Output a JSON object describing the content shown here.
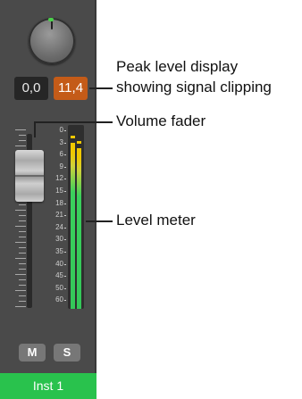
{
  "channel_strip": {
    "pan_knob": "pan-knob",
    "volume_display": "0,0",
    "peak_display": "11,4",
    "peak_color": "#c45b18",
    "meter_scale": [
      "0",
      "3",
      "6",
      "9",
      "12",
      "15",
      "18",
      "21",
      "24",
      "30",
      "35",
      "40",
      "45",
      "50",
      "60"
    ],
    "buttons": {
      "mute": "M",
      "solo": "S"
    },
    "track_name": "Inst 1",
    "track_color": "#29c24d"
  },
  "callouts": {
    "peak": [
      "Peak level display",
      "showing signal clipping"
    ],
    "fader": "Volume fader",
    "meter": "Level meter"
  }
}
